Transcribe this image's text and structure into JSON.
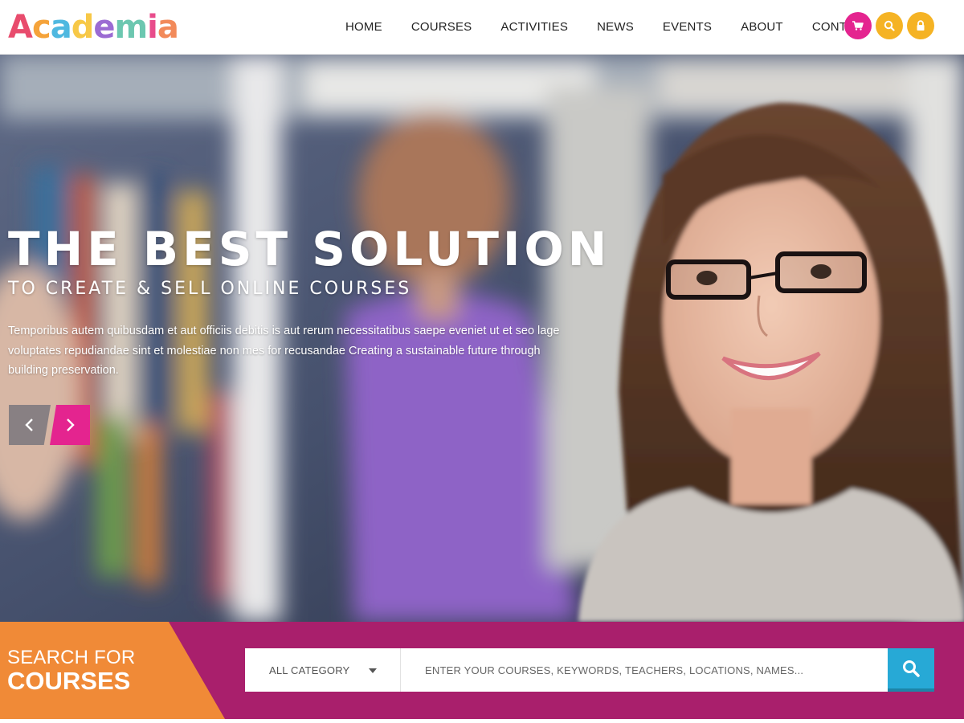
{
  "header": {
    "logo_letters": [
      {
        "char": "A",
        "color": "#e84c6d"
      },
      {
        "char": "c",
        "color": "#f5a33a"
      },
      {
        "char": "a",
        "color": "#4fb8e0"
      },
      {
        "char": "d",
        "color": "#f7c847"
      },
      {
        "char": "e",
        "color": "#9b6bd3"
      },
      {
        "char": "m",
        "color": "#6cc7b0"
      },
      {
        "char": "i",
        "color": "#e84c8b"
      },
      {
        "char": "a",
        "color": "#f28a5a"
      }
    ],
    "nav": [
      "HOME",
      "COURSES",
      "ACTIVITIES",
      "NEWS",
      "EVENTS",
      "ABOUT",
      "CONTACT"
    ],
    "icons": {
      "cart": {
        "icon": "cart-icon",
        "color": "#e4248f"
      },
      "search": {
        "icon": "search-icon",
        "color": "#f5b324"
      },
      "lock": {
        "icon": "lock-icon",
        "color": "#f5b324"
      }
    }
  },
  "hero": {
    "headline": "THE BEST SOLUTION",
    "subhead": "TO CREATE & SELL ONLINE COURSES",
    "description_lines": [
      "Temporibus autem quibusdam et aut officiis debitis is aut rerum necessitatibus saepe eveniet ut et seo lage",
      "voluptates repudiandae sint et molestiae non mes  for recusandae Creating a sustainable future through",
      "building preservation."
    ],
    "prev_icon": "chevron-left-icon",
    "next_icon": "chevron-right-icon",
    "accent": "#e4248f"
  },
  "search": {
    "label_line1": "SEARCH FOR",
    "label_line2": "COURSES",
    "category_selected": "ALL CATEGORY",
    "placeholder": "ENTER YOUR COURSES, KEYWORDS, TEACHERS, LOCATIONS, NAMES...",
    "band_color": "#a91f6c",
    "label_color": "#f08a37",
    "button_color": "#27a9d6"
  }
}
